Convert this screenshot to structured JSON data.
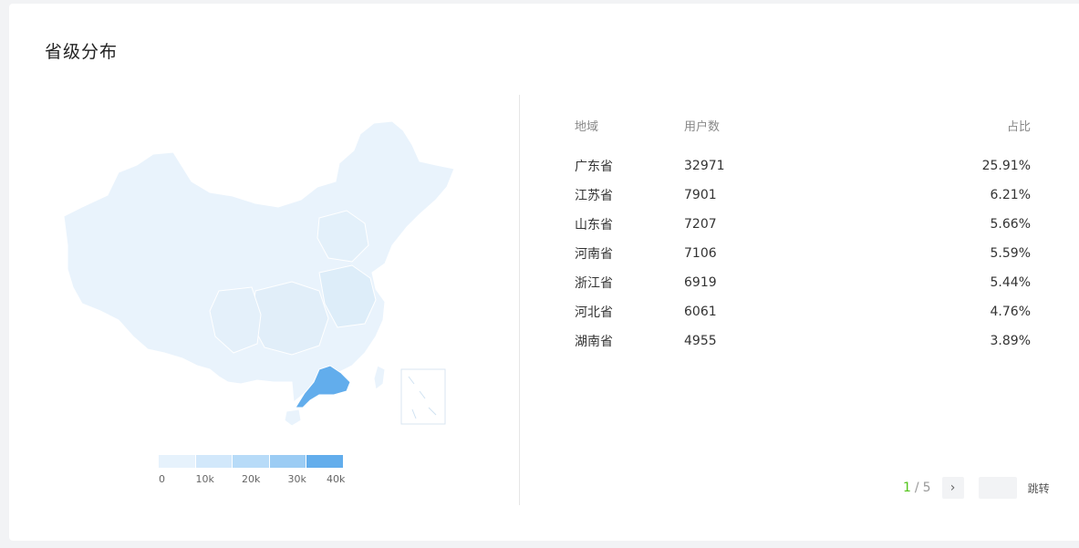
{
  "panel": {
    "title": "省级分布"
  },
  "legend": {
    "colors": [
      "#e6f2fc",
      "#d2e8fb",
      "#b7dbf8",
      "#9bccf4",
      "#62adec"
    ],
    "ticks": [
      "0",
      "10k",
      "20k",
      "30k",
      "40k"
    ]
  },
  "colors": {
    "map_base": "#e9f3fc",
    "map_mid": "#ddedf9",
    "highlight": "#62adec",
    "border": "#ffffff"
  },
  "table": {
    "headers": {
      "region": "地域",
      "users": "用户数",
      "share": "占比"
    },
    "rows": [
      {
        "region": "广东省",
        "users": "32971",
        "share": "25.91%"
      },
      {
        "region": "江苏省",
        "users": "7901",
        "share": "6.21%"
      },
      {
        "region": "山东省",
        "users": "7207",
        "share": "5.66%"
      },
      {
        "region": "河南省",
        "users": "7106",
        "share": "5.59%"
      },
      {
        "region": "浙江省",
        "users": "6919",
        "share": "5.44%"
      },
      {
        "region": "河北省",
        "users": "6061",
        "share": "4.76%"
      },
      {
        "region": "湖南省",
        "users": "4955",
        "share": "3.89%"
      }
    ]
  },
  "pagination": {
    "current": "1",
    "separator": "/",
    "total": "5",
    "next_icon": "chevron-right-icon",
    "jump_value": "",
    "jump_label": "跳转"
  }
}
